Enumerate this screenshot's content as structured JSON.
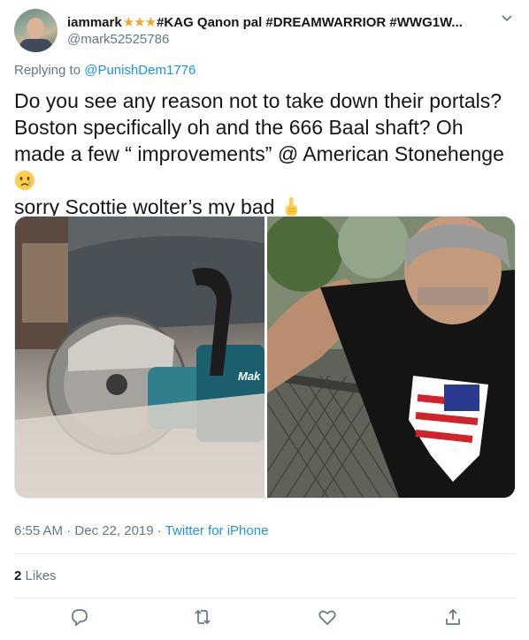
{
  "tweet": {
    "display_name_prefix": "iammark",
    "display_name_stars": "★★★",
    "display_name_suffix": "#KAG Qanon pal #DREAMWARRIOR #WWG1W...",
    "handle": "@mark52525786",
    "replying_prefix": "Replying to",
    "replying_to": "@PunishDem1776",
    "text_part1": "Do you see any reason not to take down their portals? Boston specifically oh and the 666 Baal shaft? Oh made a few “ improvements” @ American Stonehenge",
    "text_part2": "sorry Scottie wolter’s my bad",
    "emoji_1": "crying-face-emoji",
    "emoji_2": "pointing-up-emoji",
    "time": "6:55 AM",
    "separator": "·",
    "date": "Dec 22, 2019",
    "source": "Twitter for iPhone",
    "likes_count": "2",
    "likes_label": "Likes"
  },
  "media": {
    "left_photo_subject": "cut-off-saw",
    "right_photo_subject": "man-selfie",
    "saw_brand_text": "Mak"
  },
  "actions": [
    "reply-icon",
    "retweet-icon",
    "like-icon",
    "share-icon"
  ],
  "colors": {
    "link": "#1b95e0",
    "secondary_text": "#657786",
    "primary_text": "#14171a",
    "star": "#f4a623",
    "divider": "#e6ecf0"
  }
}
